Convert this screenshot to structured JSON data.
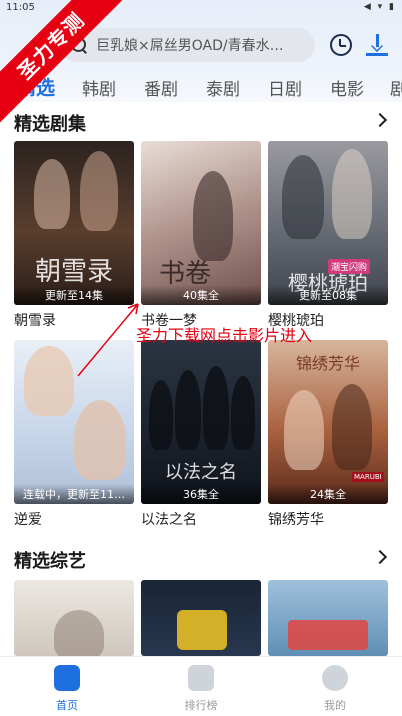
{
  "status": {
    "time": "11:05",
    "icons": "◀ ▾ ▮"
  },
  "watermark": {
    "text": "圣力专测"
  },
  "search": {
    "placeholder": "巨乳娘×屌丝男OAD/青春水…"
  },
  "tabs": [
    "精选",
    "韩剧",
    "番剧",
    "泰剧",
    "日剧",
    "电影",
    "剧"
  ],
  "sections": {
    "drama": {
      "title": "精选剧集"
    },
    "variety": {
      "title": "精选综艺"
    }
  },
  "dramas": [
    {
      "title": "朝雪录",
      "badge": "更新至14集",
      "art": "朝雪录",
      "color": "#3a2a22"
    },
    {
      "title": "书卷一梦",
      "badge": "40集全",
      "art": "书卷",
      "color": "#b8a7a0"
    },
    {
      "title": "樱桃琥珀",
      "badge": "更新至08集",
      "art": "樱桃琥珀",
      "color": "#6f6a6d"
    },
    {
      "title": "逆爱",
      "badge": "连载中，更新至11…",
      "art": "",
      "color": "#c9d7ea"
    },
    {
      "title": "以法之名",
      "badge": "36集全",
      "art": "以法之名",
      "color": "#1f2530"
    },
    {
      "title": "锦绣芳华",
      "badge": "24集全",
      "art": "锦绣芳华",
      "color": "#a35a3a"
    }
  ],
  "poster_extras": {
    "cherry_tag": "潮宝闪购",
    "brocade_tag": "MARUBI"
  },
  "annotation": {
    "text": "圣力下载网点击影片进入"
  },
  "variety_colors": [
    "#d6d0c8",
    "#1d2a3a",
    "#7fa7c9"
  ],
  "nav": [
    {
      "label": "首页",
      "icon": "home-icon",
      "active": true
    },
    {
      "label": "排行榜",
      "icon": "ranking-icon",
      "active": false
    },
    {
      "label": "我的",
      "icon": "profile-icon",
      "active": false
    }
  ],
  "colors": {
    "accent": "#1e6fe0",
    "watermark": "#e60012"
  }
}
